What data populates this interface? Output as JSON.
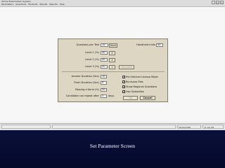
{
  "app": {
    "title": "Online Examination System",
    "menu": [
      "Parameters",
      "Questions",
      "Students",
      "Results",
      "Reports",
      "Help"
    ],
    "window_controls": [
      "_",
      "□",
      "x"
    ]
  },
  "taskbar": {
    "left": "",
    "middle": "",
    "date": "06/04/2006",
    "time": "11:00 AM"
  },
  "dialog": {
    "questions_label": "Questions per Test",
    "questions_value": "10",
    "next_label": "Next",
    "handheld_label": "Handheld Units",
    "handheld_value": "40",
    "levels": [
      {
        "label": "Level 1 (%)",
        "value": "40",
        "arrow": "4"
      },
      {
        "label": "Level 2 (%)",
        "value": "40",
        "arrow": "4"
      },
      {
        "label": "Level 3 (%)",
        "value": "20",
        "arrow": "2"
      }
    ],
    "calculate_label": "Calculate",
    "answer_label": "Answer Duration (Sec)",
    "answer_value": "10",
    "flash_label": "Flash Duration (Sec)",
    "flash_value": "5",
    "passing_label": "Passing criteria (%)",
    "passing_value": "50",
    "repeat_label": "Candidate can repeat after",
    "repeat_value": "1",
    "repeat_unit": "days",
    "options": [
      {
        "label": "Pre-Fetched License Mode",
        "checked": true
      },
      {
        "label": "Run/save Files",
        "checked": true
      },
      {
        "label": "Show Regional Questions",
        "checked": true
      },
      {
        "label": "Use OptionBox",
        "checked": true
      }
    ],
    "ok_label": "OK",
    "cancel_label": "Cancel"
  },
  "caption": "Set Parameter Screen"
}
